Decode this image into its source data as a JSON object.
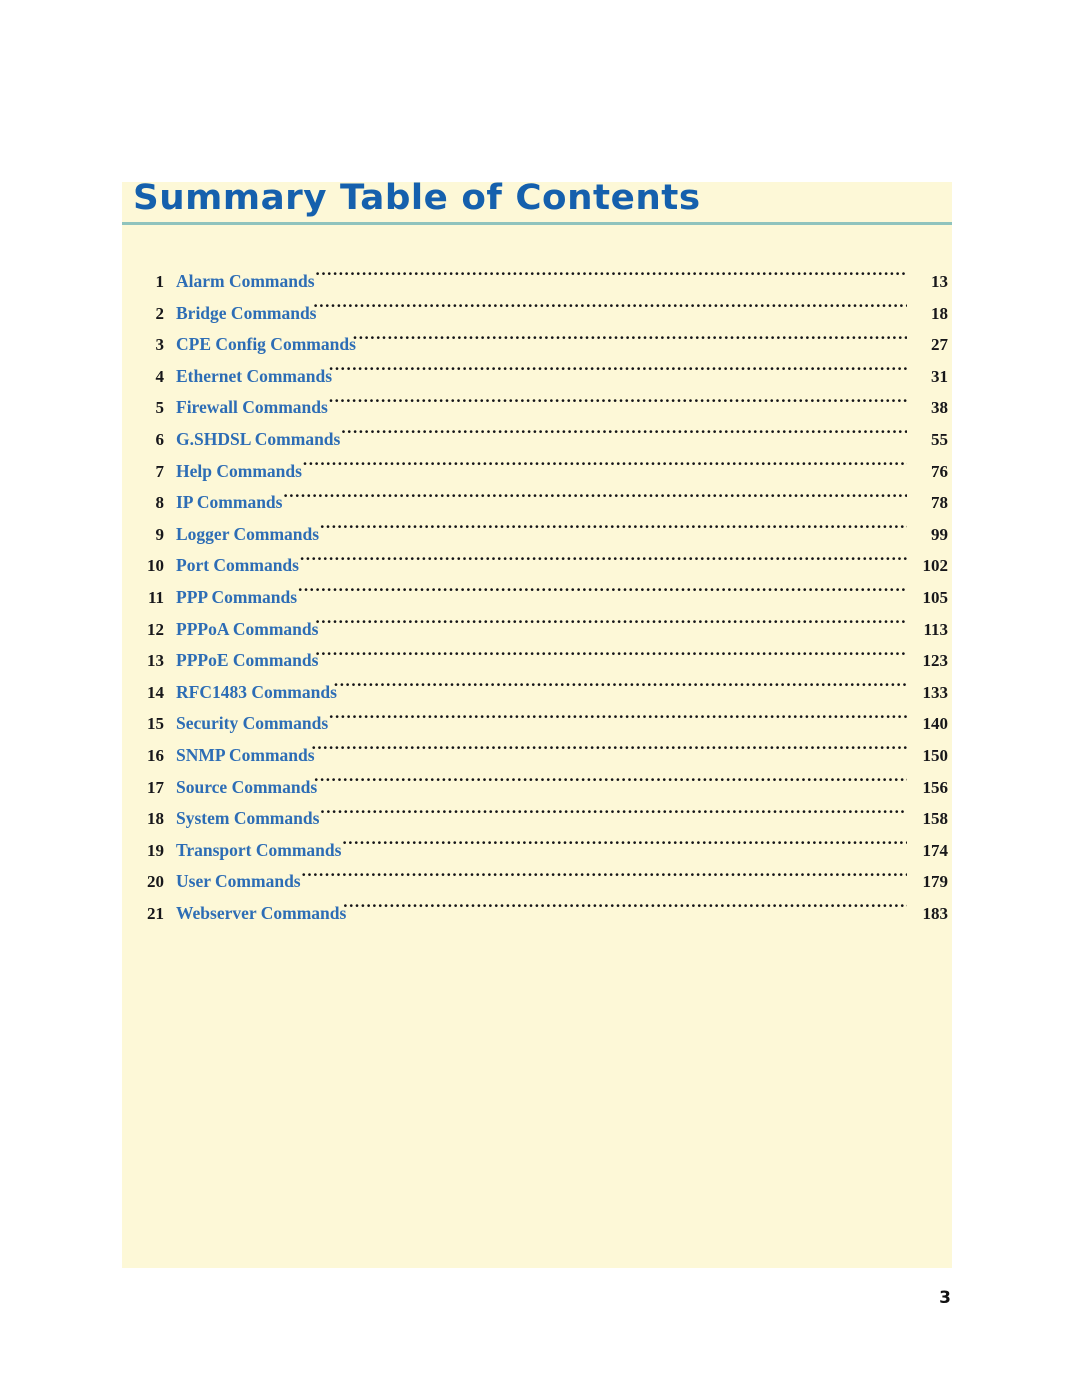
{
  "document": {
    "title": "Summary Table of Contents",
    "folio": "3",
    "colors": {
      "panel_background": "#fdf8d7",
      "page_background": "#ffffff",
      "title_blue": "#1560ad",
      "entry_blue": "#2d6db5",
      "rule_teal": "#8fc3bd",
      "number_black": "#17171a"
    }
  },
  "toc": {
    "entries": [
      {
        "num": "1",
        "label": "Alarm Commands",
        "page": "13",
        "tight": false
      },
      {
        "num": "2",
        "label": "Bridge Commands",
        "page": "18",
        "tight": true
      },
      {
        "num": "3",
        "label": "CPE Config Commands",
        "page": "27",
        "tight": true
      },
      {
        "num": "4",
        "label": "Ethernet Commands",
        "page": "31",
        "tight": true
      },
      {
        "num": "5",
        "label": "Firewall Commands",
        "page": "38",
        "tight": false
      },
      {
        "num": "6",
        "label": "G.SHDSL Commands",
        "page": "55",
        "tight": false
      },
      {
        "num": "7",
        "label": "Help Commands",
        "page": "76",
        "tight": false
      },
      {
        "num": "8",
        "label": "IP Commands",
        "page": "78",
        "tight": false
      },
      {
        "num": "9",
        "label": "Logger Commands",
        "page": "99",
        "tight": false
      },
      {
        "num": "10",
        "label": "Port Commands",
        "page": "102",
        "tight": false
      },
      {
        "num": "11",
        "label": "PPP Commands",
        "page": "105",
        "tight": false
      },
      {
        "num": "12",
        "label": "PPPoA Commands",
        "page": "113",
        "tight": true
      },
      {
        "num": "13",
        "label": "PPPoE Commands",
        "page": "123",
        "tight": true
      },
      {
        "num": "14",
        "label": "RFC1483 Commands",
        "page": "133",
        "tight": true
      },
      {
        "num": "15",
        "label": "Security Commands",
        "page": "140",
        "tight": false
      },
      {
        "num": "16",
        "label": "SNMP Commands",
        "page": "150",
        "tight": true
      },
      {
        "num": "17",
        "label": "Source Commands",
        "page": "156",
        "tight": true
      },
      {
        "num": "18",
        "label": "System Commands",
        "page": "158",
        "tight": false
      },
      {
        "num": "19",
        "label": "Transport Commands",
        "page": "174",
        "tight": false
      },
      {
        "num": "20",
        "label": "User Commands",
        "page": "179",
        "tight": false
      },
      {
        "num": "21",
        "label": "Webserver Commands",
        "page": "183",
        "tight": true
      }
    ]
  }
}
